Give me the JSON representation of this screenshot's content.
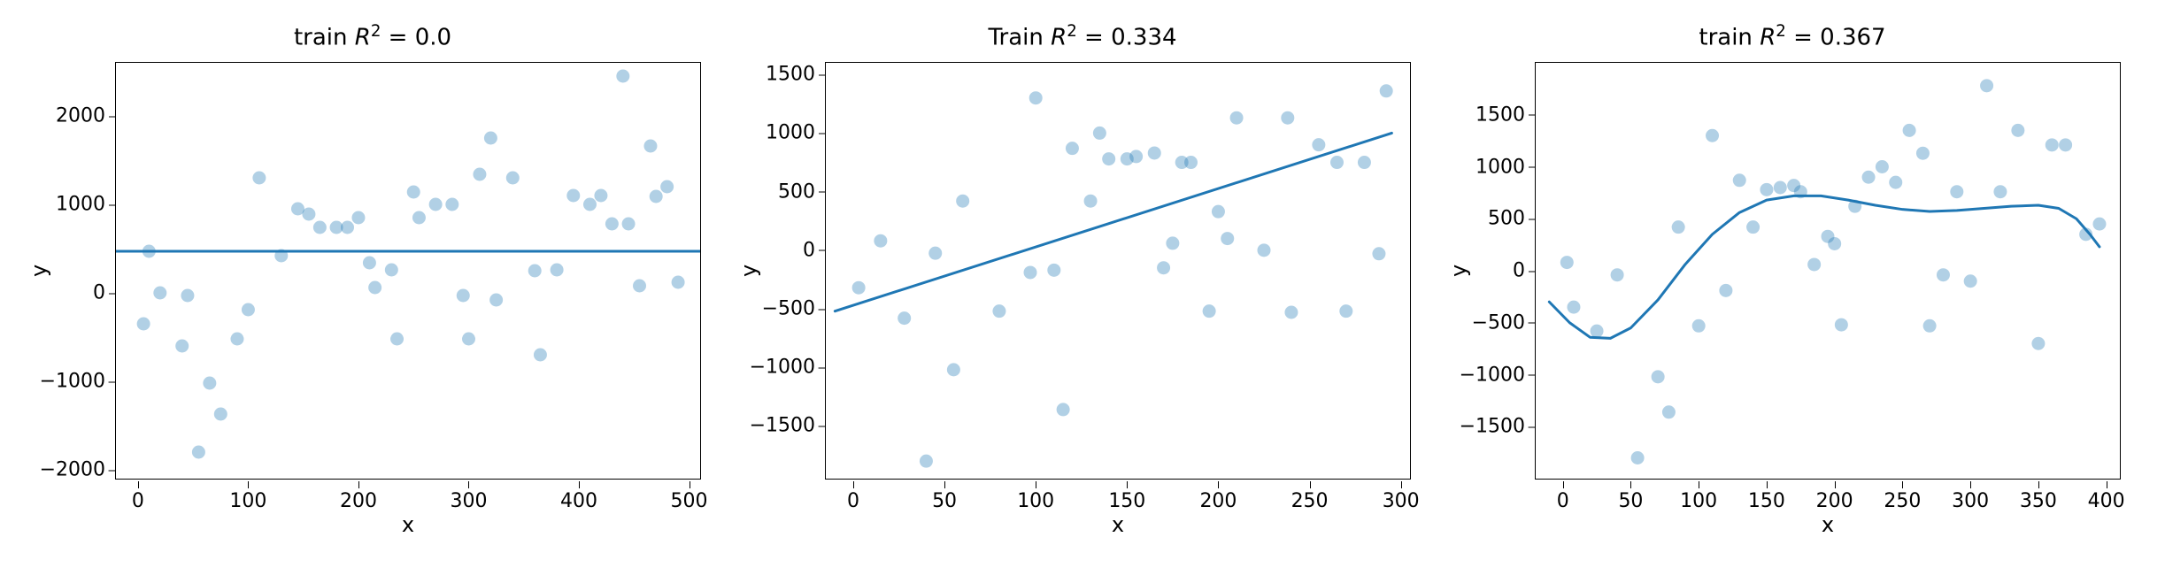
{
  "colors": {
    "accent": "#1f77b4"
  },
  "chart_data": [
    {
      "id": "chart0",
      "type": "scatter",
      "title_prefix": "train ",
      "title_var": "R",
      "title_suffix": " = 0.0",
      "xlabel": "x",
      "ylabel": "y",
      "xlim": [
        -20,
        510
      ],
      "ylim": [
        -2100,
        2600
      ],
      "xticks": [
        0,
        100,
        200,
        300,
        400,
        500
      ],
      "yticks": [
        -2000,
        -1000,
        0,
        1000,
        2000
      ],
      "points": [
        [
          5,
          -350
        ],
        [
          10,
          470
        ],
        [
          20,
          0
        ],
        [
          40,
          -600
        ],
        [
          45,
          -30
        ],
        [
          55,
          -1800
        ],
        [
          65,
          -1020
        ],
        [
          75,
          -1370
        ],
        [
          90,
          -520
        ],
        [
          100,
          -190
        ],
        [
          110,
          1300
        ],
        [
          130,
          420
        ],
        [
          145,
          950
        ],
        [
          155,
          890
        ],
        [
          165,
          740
        ],
        [
          180,
          740
        ],
        [
          190,
          740
        ],
        [
          200,
          850
        ],
        [
          210,
          340
        ],
        [
          215,
          60
        ],
        [
          230,
          260
        ],
        [
          235,
          -520
        ],
        [
          250,
          1140
        ],
        [
          255,
          850
        ],
        [
          270,
          1000
        ],
        [
          285,
          1000
        ],
        [
          295,
          -30
        ],
        [
          300,
          -520
        ],
        [
          310,
          1340
        ],
        [
          320,
          1750
        ],
        [
          325,
          -80
        ],
        [
          340,
          1300
        ],
        [
          360,
          250
        ],
        [
          365,
          -700
        ],
        [
          380,
          260
        ],
        [
          395,
          1100
        ],
        [
          410,
          1000
        ],
        [
          420,
          1100
        ],
        [
          430,
          780
        ],
        [
          440,
          2450
        ],
        [
          445,
          780
        ],
        [
          455,
          80
        ],
        [
          465,
          1660
        ],
        [
          470,
          1090
        ],
        [
          480,
          1200
        ],
        [
          490,
          120
        ]
      ],
      "fit": {
        "type": "hline",
        "y": 470
      }
    },
    {
      "id": "chart1",
      "type": "scatter",
      "title_prefix": "Train ",
      "title_var": "R",
      "title_suffix": " = 0.334",
      "xlabel": "x",
      "ylabel": "y",
      "xlim": [
        -15,
        305
      ],
      "ylim": [
        -1950,
        1600
      ],
      "xticks": [
        0,
        50,
        100,
        150,
        200,
        250,
        300
      ],
      "yticks": [
        -1500,
        -1000,
        -500,
        0,
        500,
        1000,
        1500
      ],
      "points": [
        [
          3,
          -320
        ],
        [
          15,
          80
        ],
        [
          28,
          -580
        ],
        [
          40,
          -1800
        ],
        [
          45,
          -25
        ],
        [
          55,
          -1020
        ],
        [
          60,
          420
        ],
        [
          80,
          -520
        ],
        [
          97,
          -190
        ],
        [
          100,
          1300
        ],
        [
          110,
          -170
        ],
        [
          115,
          -1360
        ],
        [
          120,
          870
        ],
        [
          130,
          420
        ],
        [
          135,
          1000
        ],
        [
          140,
          780
        ],
        [
          150,
          780
        ],
        [
          155,
          800
        ],
        [
          165,
          830
        ],
        [
          170,
          -150
        ],
        [
          175,
          60
        ],
        [
          180,
          750
        ],
        [
          185,
          750
        ],
        [
          195,
          -520
        ],
        [
          200,
          330
        ],
        [
          205,
          100
        ],
        [
          210,
          1130
        ],
        [
          225,
          0
        ],
        [
          238,
          1130
        ],
        [
          240,
          -530
        ],
        [
          255,
          900
        ],
        [
          265,
          750
        ],
        [
          270,
          -520
        ],
        [
          280,
          750
        ],
        [
          288,
          -30
        ],
        [
          292,
          1360
        ]
      ],
      "fit": {
        "type": "line",
        "x0": -10,
        "y0": -520,
        "x1": 295,
        "y1": 1000
      }
    },
    {
      "id": "chart2",
      "type": "scatter",
      "title_prefix": "train ",
      "title_var": "R",
      "title_suffix": " = 0.367",
      "xlabel": "x",
      "ylabel": "y",
      "xlim": [
        -20,
        410
      ],
      "ylim": [
        -2000,
        2000
      ],
      "xticks": [
        0,
        50,
        100,
        150,
        200,
        250,
        300,
        350,
        400
      ],
      "yticks": [
        -1500,
        -1000,
        -500,
        0,
        500,
        1000,
        1500
      ],
      "points": [
        [
          3,
          80
        ],
        [
          8,
          -350
        ],
        [
          25,
          -580
        ],
        [
          40,
          -40
        ],
        [
          55,
          -1800
        ],
        [
          70,
          -1020
        ],
        [
          78,
          -1360
        ],
        [
          85,
          420
        ],
        [
          100,
          -530
        ],
        [
          110,
          1300
        ],
        [
          120,
          -190
        ],
        [
          130,
          870
        ],
        [
          140,
          420
        ],
        [
          150,
          780
        ],
        [
          160,
          800
        ],
        [
          170,
          820
        ],
        [
          175,
          760
        ],
        [
          185,
          60
        ],
        [
          195,
          330
        ],
        [
          200,
          260
        ],
        [
          205,
          -520
        ],
        [
          215,
          620
        ],
        [
          225,
          900
        ],
        [
          235,
          1000
        ],
        [
          245,
          850
        ],
        [
          255,
          1350
        ],
        [
          265,
          1130
        ],
        [
          270,
          -530
        ],
        [
          280,
          -40
        ],
        [
          290,
          760
        ],
        [
          300,
          -100
        ],
        [
          312,
          1780
        ],
        [
          322,
          760
        ],
        [
          335,
          1350
        ],
        [
          350,
          -700
        ],
        [
          360,
          1210
        ],
        [
          370,
          1210
        ],
        [
          385,
          350
        ],
        [
          395,
          450
        ]
      ],
      "fit": {
        "type": "curve",
        "points": [
          [
            -10,
            -300
          ],
          [
            5,
            -500
          ],
          [
            20,
            -640
          ],
          [
            35,
            -650
          ],
          [
            50,
            -550
          ],
          [
            70,
            -280
          ],
          [
            90,
            60
          ],
          [
            110,
            350
          ],
          [
            130,
            560
          ],
          [
            150,
            680
          ],
          [
            170,
            720
          ],
          [
            190,
            720
          ],
          [
            210,
            680
          ],
          [
            230,
            630
          ],
          [
            250,
            590
          ],
          [
            270,
            570
          ],
          [
            290,
            580
          ],
          [
            310,
            600
          ],
          [
            330,
            620
          ],
          [
            350,
            630
          ],
          [
            365,
            600
          ],
          [
            378,
            500
          ],
          [
            388,
            350
          ],
          [
            395,
            230
          ]
        ]
      }
    }
  ]
}
